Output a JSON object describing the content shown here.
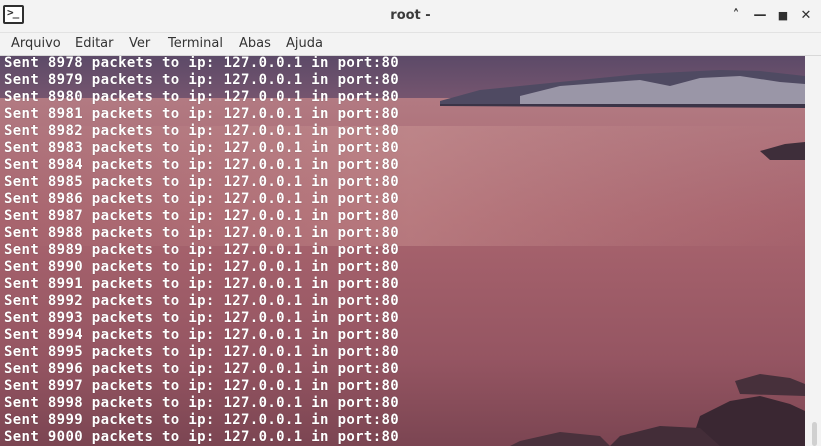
{
  "window": {
    "title": "root -",
    "app_icon_glyph": ">_",
    "controls": {
      "minimize_glyph": "˄",
      "restore_glyph": "—",
      "maximize_glyph": "■",
      "close_glyph": "✕"
    }
  },
  "menu": {
    "items": [
      "Arquivo",
      "Editar",
      "Ver",
      "Terminal",
      "Abas",
      "Ajuda"
    ]
  },
  "terminal": {
    "lines": [
      "Sent 8978 packets to ip: 127.0.0.1 in port:80",
      "Sent 8979 packets to ip: 127.0.0.1 in port:80",
      "Sent 8980 packets to ip: 127.0.0.1 in port:80",
      "Sent 8981 packets to ip: 127.0.0.1 in port:80",
      "Sent 8982 packets to ip: 127.0.0.1 in port:80",
      "Sent 8983 packets to ip: 127.0.0.1 in port:80",
      "Sent 8984 packets to ip: 127.0.0.1 in port:80",
      "Sent 8985 packets to ip: 127.0.0.1 in port:80",
      "Sent 8986 packets to ip: 127.0.0.1 in port:80",
      "Sent 8987 packets to ip: 127.0.0.1 in port:80",
      "Sent 8988 packets to ip: 127.0.0.1 in port:80",
      "Sent 8989 packets to ip: 127.0.0.1 in port:80",
      "Sent 8990 packets to ip: 127.0.0.1 in port:80",
      "Sent 8991 packets to ip: 127.0.0.1 in port:80",
      "Sent 8992 packets to ip: 127.0.0.1 in port:80",
      "Sent 8993 packets to ip: 127.0.0.1 in port:80",
      "Sent 8994 packets to ip: 127.0.0.1 in port:80",
      "Sent 8995 packets to ip: 127.0.0.1 in port:80",
      "Sent 8996 packets to ip: 127.0.0.1 in port:80",
      "Sent 8997 packets to ip: 127.0.0.1 in port:80",
      "Sent 8998 packets to ip: 127.0.0.1 in port:80",
      "Sent 8999 packets to ip: 127.0.0.1 in port:80",
      "Sent 9000 packets to ip: 127.0.0.1 in port:80"
    ],
    "text_color": "#ffffff",
    "background_image": "lake-sunset-wallpaper"
  },
  "colors": {
    "titlebar_bg": "#f3f3f3",
    "sky_top": "#5a4a66",
    "water_mid": "#a8606a",
    "water_bottom": "#8a4a54"
  }
}
